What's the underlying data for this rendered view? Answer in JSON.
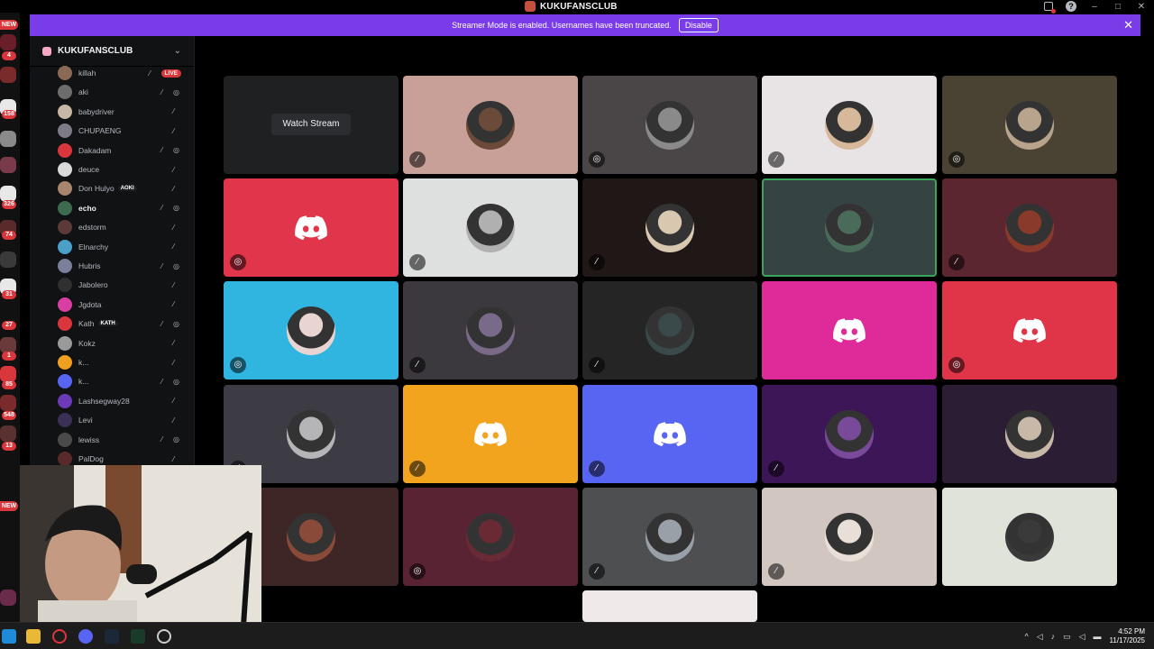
{
  "window": {
    "title": "KUKUFANSCLUB",
    "controls": [
      "–",
      "□",
      "✕"
    ]
  },
  "server_rail": {
    "badges": [
      "NEW",
      "4",
      "158",
      "326",
      "74",
      "31",
      "27",
      "1",
      "85",
      "548",
      "13",
      "NEW"
    ]
  },
  "banner": {
    "text": "Streamer Mode is enabled. Usernames have been truncated.",
    "button_label": "Disable",
    "close_label": "✕"
  },
  "sidebar": {
    "server_name": "KUKUFANSCLUB",
    "chevron": "⌄",
    "members": [
      {
        "name": "killah",
        "live": "LIVE",
        "avatar_color": "#8a6a55"
      },
      {
        "name": "aki",
        "avatar_color": "#6d6d6d"
      },
      {
        "name": "babydriver",
        "avatar_color": "#c7b7a4"
      },
      {
        "name": "CHUPAENG",
        "avatar_color": "#7d7b86"
      },
      {
        "name": "Dakadam",
        "avatar_color": "#da373c"
      },
      {
        "name": "deuce",
        "avatar_color": "#d9d9d9"
      },
      {
        "name": "Don Hulyo",
        "tag": "AOKI",
        "avatar_color": "#a7856e"
      },
      {
        "name": "echo",
        "bold": true,
        "avatar_color": "#3d6b4f"
      },
      {
        "name": "edstorm",
        "avatar_color": "#5d3a3a"
      },
      {
        "name": "Elnarchy",
        "avatar_color": "#4aa0c8"
      },
      {
        "name": "Hubris",
        "avatar_color": "#7a7f9a"
      },
      {
        "name": "Jabolero",
        "avatar_color": "#2f2f2f"
      },
      {
        "name": "Jgdota",
        "avatar_color": "#d93fa3"
      },
      {
        "name": "Kath",
        "tag": "KATH",
        "avatar_color": "#da373c"
      },
      {
        "name": "Kokz",
        "avatar_color": "#9a9a9a"
      },
      {
        "name": "k...",
        "avatar_color": "#f0a020"
      },
      {
        "name": "k...",
        "avatar_color": "#5865f2"
      },
      {
        "name": "Lashsegway28",
        "avatar_color": "#6a3ab8"
      },
      {
        "name": "Levi",
        "avatar_color": "#3a2f55"
      },
      {
        "name": "lewiss",
        "avatar_color": "#4a4a4a"
      },
      {
        "name": "PalDog",
        "avatar_color": "#5a2a2a"
      }
    ]
  },
  "stage": {
    "watch_stream_label": "Watch Stream",
    "tiles": [
      {
        "bg": "#1f2022",
        "kind": "stream"
      },
      {
        "bg": "#c9a098",
        "kind": "avatar",
        "avatar": "#6b4a3a",
        "badge": "mic-off"
      },
      {
        "bg": "#4a4546",
        "kind": "avatar",
        "avatar": "#8a8a8a",
        "badge": "deafened"
      },
      {
        "bg": "#e8e4e6",
        "kind": "avatar",
        "avatar": "#d8b89a",
        "badge": "mic-off"
      },
      {
        "bg": "#4a4233",
        "kind": "avatar",
        "avatar": "#b8a48c",
        "badge": "deafened"
      },
      {
        "bg": "#e0354a",
        "kind": "discord",
        "badge": "deafened"
      },
      {
        "bg": "#dde0de",
        "kind": "avatar",
        "avatar": "#b0b0b0",
        "badge": "mic-off"
      },
      {
        "bg": "#201817",
        "kind": "avatar",
        "avatar": "#d8c8b0",
        "badge": "mic-off"
      },
      {
        "bg": "#354443",
        "kind": "avatar",
        "avatar": "#4a6a5a",
        "speaking": true
      },
      {
        "bg": "#5c2631",
        "kind": "avatar",
        "avatar": "#8a3a2a",
        "badge": "mic-off"
      },
      {
        "bg": "#2fb5e0",
        "kind": "avatar",
        "avatar": "#e8d4d0",
        "badge": "deafened"
      },
      {
        "bg": "#3b393e",
        "kind": "avatar",
        "avatar": "#7a6a8a",
        "badge": "mic-off"
      },
      {
        "bg": "#252525",
        "kind": "avatar",
        "avatar": "#3a4a4a",
        "badge": "mic-off"
      },
      {
        "bg": "#df2a9a",
        "kind": "discord"
      },
      {
        "bg": "#e03548",
        "kind": "discord",
        "badge": "deafened"
      },
      {
        "bg": "#3d3c45",
        "kind": "avatar",
        "avatar": "#b5b5b8",
        "badge": "mic-off"
      },
      {
        "bg": "#f2a41e",
        "kind": "discord",
        "badge": "mic-off"
      },
      {
        "bg": "#5865f2",
        "kind": "discord",
        "badge": "mic-off"
      },
      {
        "bg": "#3d1657",
        "kind": "avatar",
        "avatar": "#7a4a9a",
        "badge": "mic-off"
      },
      {
        "bg": "#2b1e34",
        "kind": "avatar",
        "avatar": "#c8b8a8"
      },
      {
        "bg": "#3e2626",
        "kind": "avatar",
        "avatar": "#8a4a3a"
      },
      {
        "bg": "#5a2334",
        "kind": "avatar",
        "avatar": "#6a2a35",
        "badge": "deafened"
      },
      {
        "bg": "#4d4f50",
        "kind": "avatar",
        "avatar": "#9aa0a8",
        "badge": "mic-off"
      },
      {
        "bg": "#d2c7c0",
        "kind": "avatar",
        "avatar": "#e8e0d8",
        "badge": "mic-off"
      },
      {
        "bg": "#dfe3d9",
        "kind": "avatar",
        "avatar": "#3a3a3a"
      },
      {
        "bg": "#efe9ea",
        "kind": "partial"
      }
    ]
  },
  "taskbar": {
    "time": "4:52 PM",
    "date": "11/17/2025",
    "tray_arrow": "^"
  }
}
